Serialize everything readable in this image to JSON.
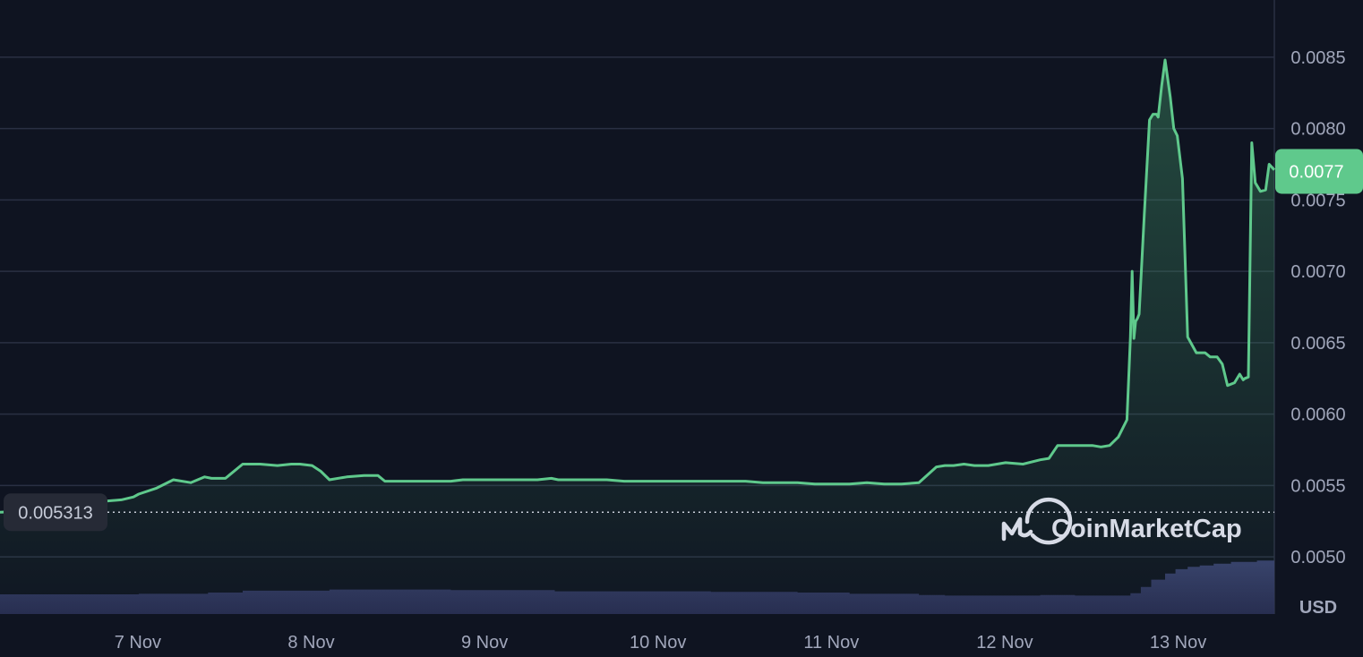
{
  "chart_data": {
    "type": "area",
    "currency": "USD",
    "x_ticks": [
      "7 Nov",
      "8 Nov",
      "9 Nov",
      "10 Nov",
      "11 Nov",
      "12 Nov",
      "13 Nov"
    ],
    "x_range_days": [
      6.2,
      13.55
    ],
    "ylim": [
      0.0046,
      0.0089
    ],
    "y_ticks": [
      "0.0050",
      "0.0055",
      "0.0060",
      "0.0065",
      "0.0070",
      "0.0075",
      "0.0080",
      "0.0085"
    ],
    "grid": true,
    "open_price": "0.005313",
    "current_price": "0.0077",
    "watermark": "CoinMarketCap",
    "series": [
      {
        "x": [
          6.2,
          6.35,
          6.42,
          6.47,
          6.52,
          6.55,
          6.6,
          6.7,
          6.8,
          6.9,
          6.97,
          7.0,
          7.1,
          7.2,
          7.3,
          7.38,
          7.42,
          7.5,
          7.6,
          7.7,
          7.8,
          7.88,
          7.93,
          8.0,
          8.05,
          8.1,
          8.2,
          8.3,
          8.38,
          8.42,
          8.5,
          8.6,
          8.7,
          8.8,
          8.87,
          8.9,
          8.97,
          9.0,
          9.03,
          9.1,
          9.2,
          9.3,
          9.38,
          9.42,
          9.5,
          9.6,
          9.7,
          9.8,
          9.9,
          10.0,
          10.1,
          10.2,
          10.3,
          10.4,
          10.5,
          10.6,
          10.7,
          10.8,
          10.9,
          11.0,
          11.1,
          11.2,
          11.3,
          11.4,
          11.5,
          11.6,
          11.65,
          11.7,
          11.76,
          11.82,
          11.85,
          11.9,
          12.0,
          12.1,
          12.2,
          12.25,
          12.3,
          12.4,
          12.5,
          12.55,
          12.6,
          12.65,
          12.7,
          12.72,
          12.73,
          12.74,
          12.75,
          12.76,
          12.77,
          12.8,
          12.83,
          12.85,
          12.86,
          12.87,
          12.88,
          12.9,
          12.92,
          12.95,
          12.97,
          12.99,
          13.02,
          13.05,
          13.1,
          13.15,
          13.18,
          13.22,
          13.25,
          13.28,
          13.32,
          13.35,
          13.37,
          13.38,
          13.4,
          13.42,
          13.44,
          13.47,
          13.5,
          13.52,
          13.55
        ],
        "y": [
          0.005313,
          0.00532,
          0.00531,
          0.00536,
          0.00538,
          0.00539,
          0.00539,
          0.00538,
          0.00539,
          0.0054,
          0.00542,
          0.00544,
          0.00548,
          0.00554,
          0.00552,
          0.00556,
          0.00555,
          0.00555,
          0.00565,
          0.00565,
          0.00564,
          0.00565,
          0.00565,
          0.00564,
          0.0056,
          0.00554,
          0.00556,
          0.00557,
          0.00557,
          0.00553,
          0.00553,
          0.00553,
          0.00553,
          0.00553,
          0.00554,
          0.00554,
          0.00554,
          0.00554,
          0.00554,
          0.00554,
          0.00554,
          0.00554,
          0.00555,
          0.00554,
          0.00554,
          0.00554,
          0.00554,
          0.00553,
          0.00553,
          0.00553,
          0.00553,
          0.00553,
          0.00553,
          0.00553,
          0.00553,
          0.00552,
          0.00552,
          0.00552,
          0.00551,
          0.00551,
          0.00551,
          0.00552,
          0.00551,
          0.00551,
          0.00552,
          0.00563,
          0.00564,
          0.00564,
          0.00565,
          0.00564,
          0.00564,
          0.00564,
          0.00566,
          0.00565,
          0.00568,
          0.00569,
          0.00578,
          0.00578,
          0.00578,
          0.00577,
          0.00578,
          0.00584,
          0.00596,
          0.00654,
          0.007,
          0.00653,
          0.00665,
          0.00667,
          0.0067,
          0.0074,
          0.00806,
          0.0081,
          0.0081,
          0.0081,
          0.00808,
          0.0083,
          0.00848,
          0.00822,
          0.008,
          0.00795,
          0.00765,
          0.00654,
          0.00643,
          0.00643,
          0.0064,
          0.0064,
          0.00635,
          0.0062,
          0.00622,
          0.00628,
          0.00624,
          0.00625,
          0.00626,
          0.0079,
          0.00762,
          0.00756,
          0.00757,
          0.00775,
          0.00771
        ]
      }
    ],
    "volume_series": {
      "x": [
        6.2,
        6.95,
        7.0,
        7.4,
        7.6,
        8.0,
        8.1,
        8.6,
        8.8,
        9.2,
        9.4,
        10.0,
        10.3,
        10.6,
        10.8,
        11.0,
        11.1,
        11.4,
        11.5,
        11.65,
        11.7,
        12.2,
        12.4,
        12.7,
        12.72,
        12.78,
        12.84,
        12.92,
        12.98,
        13.05,
        13.12,
        13.2,
        13.3,
        13.45,
        13.55
      ],
      "y": [
        0.032,
        0.032,
        0.033,
        0.035,
        0.038,
        0.038,
        0.04,
        0.04,
        0.039,
        0.039,
        0.037,
        0.037,
        0.036,
        0.036,
        0.035,
        0.035,
        0.033,
        0.033,
        0.031,
        0.03,
        0.03,
        0.031,
        0.03,
        0.03,
        0.034,
        0.044,
        0.056,
        0.066,
        0.073,
        0.077,
        0.079,
        0.082,
        0.085,
        0.087,
        0.088
      ]
    }
  }
}
